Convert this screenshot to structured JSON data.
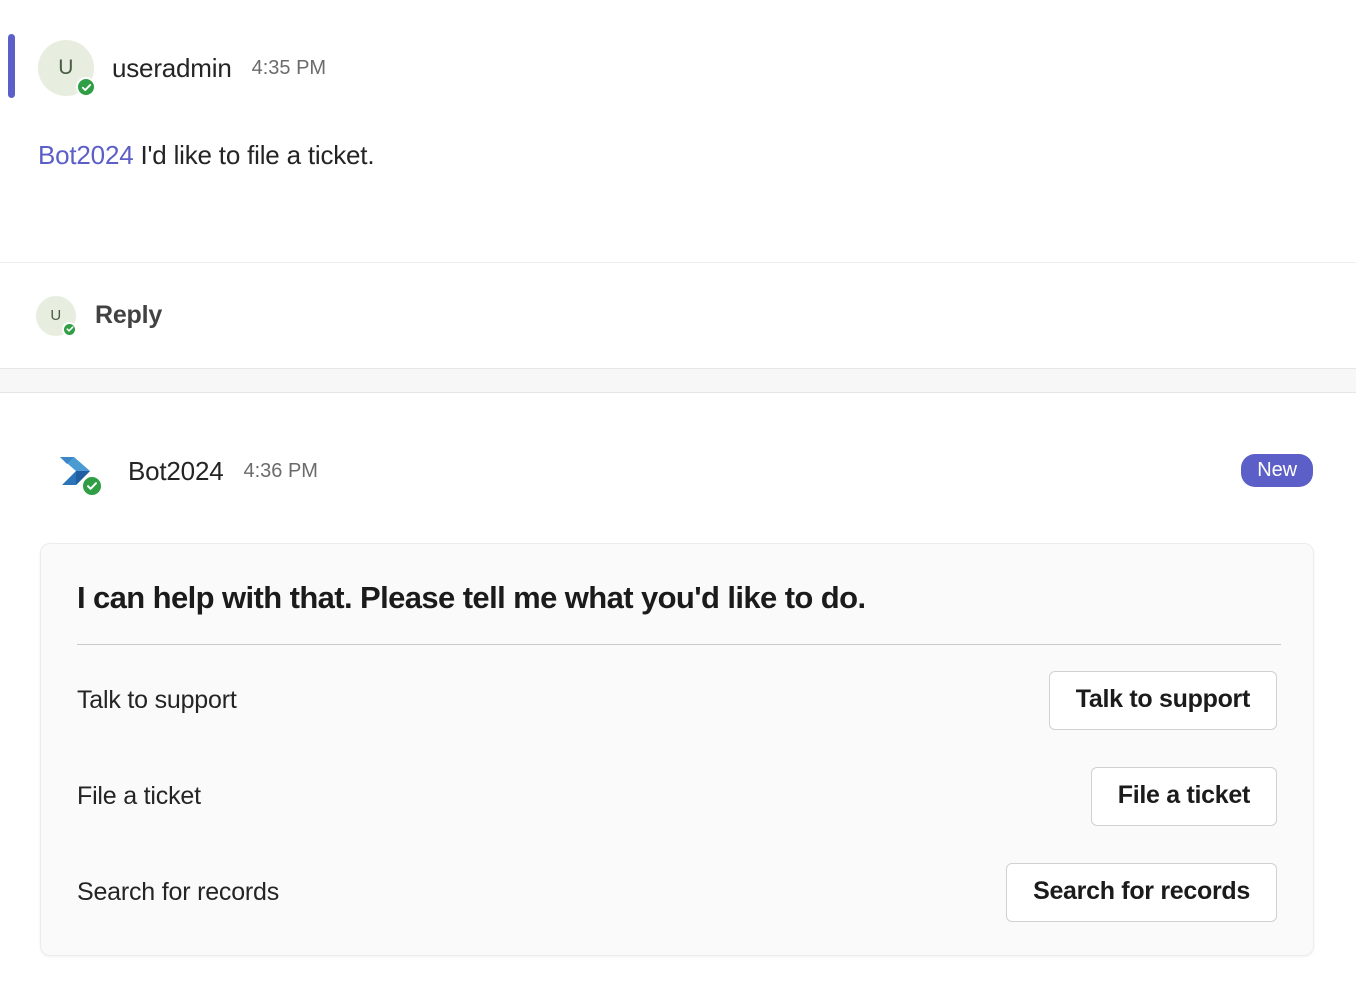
{
  "theme": {
    "accent_purple": "#5b5fc7",
    "presence_green": "#2f9e44",
    "avatar_bg": "#e7eedf",
    "card_bg": "#fafafa",
    "page_bg": "#ffffff"
  },
  "user_message": {
    "accent_bar_name": "unread-accent-bar",
    "avatar_initial": "U",
    "presence_icon": "available-checkmark-icon",
    "author": "useradmin",
    "timestamp": "4:35 PM",
    "mention": "Bot2024",
    "text": " I'd like to file a ticket."
  },
  "reply": {
    "avatar_initial": "U",
    "presence_icon": "available-checkmark-icon",
    "label": "Reply"
  },
  "bot_message": {
    "logo_icon": "power-automate-logo-icon",
    "presence_icon": "available-checkmark-icon",
    "author": "Bot2024",
    "timestamp": "4:36 PM",
    "badge": "New",
    "card": {
      "title": "I can help with that. Please tell me what you'd like to do.",
      "rows": [
        {
          "label": "Talk to support",
          "button": "Talk to support"
        },
        {
          "label": "File a ticket",
          "button": "File a ticket"
        },
        {
          "label": "Search for records",
          "button": "Search for records"
        }
      ]
    }
  }
}
